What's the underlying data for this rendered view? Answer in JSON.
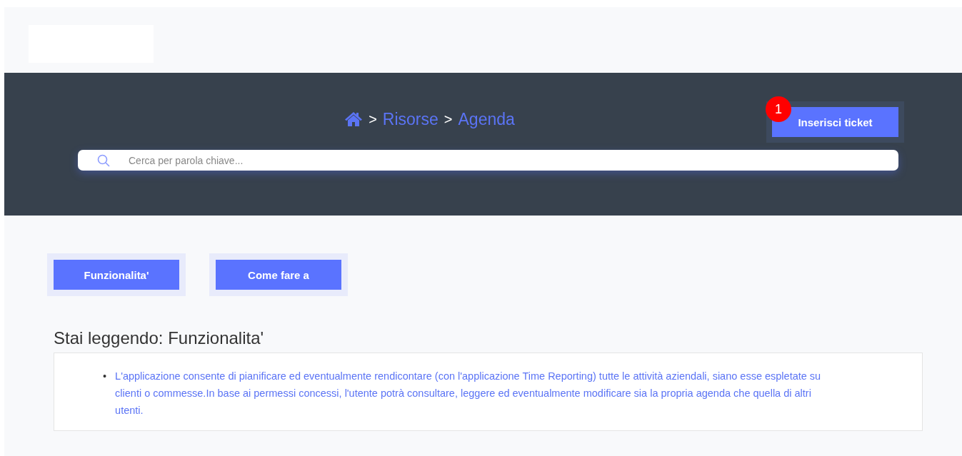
{
  "breadcrumb": [
    {
      "kind": "home"
    },
    {
      "kind": "separator",
      "text": ">"
    },
    {
      "kind": "link",
      "text": "Risorse"
    },
    {
      "kind": "separator",
      "text": ">"
    },
    {
      "kind": "link",
      "text": "Agenda"
    }
  ],
  "ticket_button": {
    "label": "Inserisci ticket",
    "badge": "1"
  },
  "search": {
    "placeholder": "Cerca per parola chiave..."
  },
  "tabs": [
    {
      "label": "Funzionalita'"
    },
    {
      "label": "Come fare a"
    }
  ],
  "section": {
    "title": "Stai leggendo: Funzionalita'",
    "items": [
      {
        "bullet": "•",
        "text": "L'applicazione consente di pianificare ed eventualmente rendicontare (con l'applicazione Time Reporting) tutte le attività aziendali, siano esse espletate su clienti o commesse.In base ai permessi concessi, l'utente potrà consultare, leggere ed eventualmente modificare sia la propria agenda che quella di altri utenti."
      }
    ]
  }
}
